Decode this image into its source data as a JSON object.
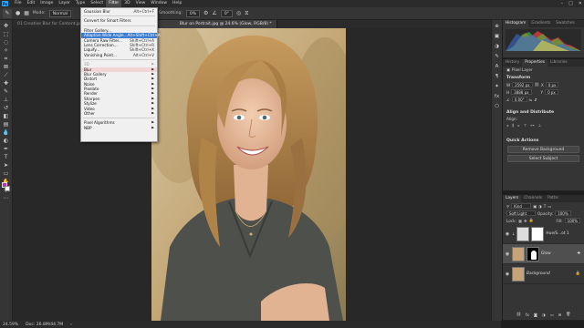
{
  "menubar": {
    "app_icon": "Ps",
    "items": [
      "File",
      "Edit",
      "Image",
      "Layer",
      "Type",
      "Select",
      "Filter",
      "3D",
      "View",
      "Window",
      "Help"
    ],
    "active_index": 6
  },
  "optionsbar": {
    "mode_label": "Mode:",
    "mode_value": "Normal",
    "flow_label": "Flow:",
    "flow_value": "100%",
    "smoothing_label": "Smoothing:",
    "smoothing_value": "0%",
    "angle_value": "0°"
  },
  "document": {
    "tabs": [
      {
        "label": "01 Creative Blur for Content.jpg",
        "active": false
      },
      {
        "label": "Blur on Portrait.jpg @ 24.6% (Glow, RGB/8) *",
        "active": true
      }
    ]
  },
  "filter_menu": {
    "items": [
      {
        "label": "Gaussian Blur",
        "shortcut": "Alt+Ctrl+F",
        "type": "item"
      },
      {
        "type": "sep"
      },
      {
        "label": "Convert for Smart Filters",
        "shortcut": "",
        "type": "item"
      },
      {
        "type": "sep"
      },
      {
        "label": "Filter Gallery...",
        "shortcut": "",
        "type": "item"
      },
      {
        "label": "Adaptive Wide Angle...",
        "shortcut": "Alt+Shift+Ctrl+A",
        "type": "highlight"
      },
      {
        "label": "Camera Raw Filter...",
        "shortcut": "Shift+Ctrl+A",
        "type": "item"
      },
      {
        "label": "Lens Correction...",
        "shortcut": "Shift+Ctrl+R",
        "type": "item"
      },
      {
        "label": "Liquify...",
        "shortcut": "Shift+Ctrl+X",
        "type": "item"
      },
      {
        "label": "Vanishing Point...",
        "shortcut": "Alt+Ctrl+V",
        "type": "item"
      },
      {
        "type": "sep"
      },
      {
        "label": "3D",
        "shortcut": "",
        "type": "submenu-disabled"
      },
      {
        "label": "Blur",
        "shortcut": "",
        "type": "submenu-hover"
      },
      {
        "label": "Blur Gallery",
        "shortcut": "",
        "type": "submenu"
      },
      {
        "label": "Distort",
        "shortcut": "",
        "type": "submenu"
      },
      {
        "label": "Noise",
        "shortcut": "",
        "type": "submenu"
      },
      {
        "label": "Pixelate",
        "shortcut": "",
        "type": "submenu"
      },
      {
        "label": "Render",
        "shortcut": "",
        "type": "submenu"
      },
      {
        "label": "Sharpen",
        "shortcut": "",
        "type": "submenu"
      },
      {
        "label": "Stylize",
        "shortcut": "",
        "type": "submenu"
      },
      {
        "label": "Video",
        "shortcut": "",
        "type": "submenu"
      },
      {
        "label": "Other",
        "shortcut": "",
        "type": "submenu"
      },
      {
        "type": "sep"
      },
      {
        "label": "Pixel Algorithms",
        "shortcut": "",
        "type": "submenu"
      },
      {
        "label": "NBP",
        "shortcut": "",
        "type": "submenu"
      }
    ]
  },
  "statusbar": {
    "zoom": "24.59%",
    "doc_info": "Doc: 26.8M/44.7M"
  },
  "panels": {
    "histogram_tabs": [
      "Histogram",
      "Gradients",
      "Swatches"
    ],
    "properties_tabs": [
      "History",
      "Properties",
      "Libraries"
    ],
    "properties_kind": "Pixel Layer",
    "transform_title": "Transform",
    "w_label": "W",
    "w_value": "2592 px",
    "h_label": "H",
    "h_value": "3888 px",
    "x_label": "X",
    "x_value": "0 px",
    "y_label": "Y",
    "y_value": "0 px",
    "angle_value": "0.00°",
    "align_title": "Align and Distribute",
    "align_sub": "Align:",
    "quick_title": "Quick Actions",
    "remove_bg": "Remove Background",
    "select_subject": "Select Subject",
    "layers_tabs": [
      "Layers",
      "Channels",
      "Paths"
    ],
    "kind_filter": "Kind",
    "blend_mode": "Soft Light",
    "opacity_label": "Opacity:",
    "opacity_value": "100%",
    "lock_label": "Lock:",
    "fill_label": "Fill:",
    "fill_value": "100%",
    "layers": [
      {
        "name": "Hue/S...ot 1",
        "selected": false
      },
      {
        "name": "Glow",
        "selected": true
      },
      {
        "name": "Background",
        "selected": false
      }
    ]
  },
  "colors": {
    "foreground": "#c02bb5",
    "background": "#ffffff",
    "menu_highlight": "#3b7bd1",
    "accent": "#31a8ff"
  }
}
